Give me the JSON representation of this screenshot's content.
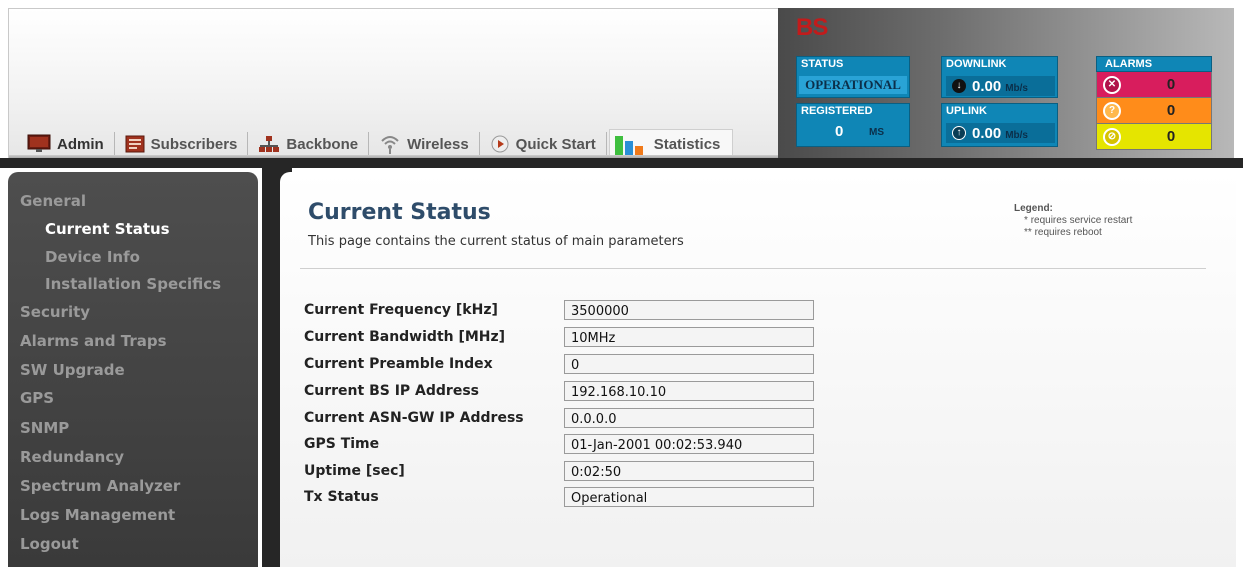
{
  "tabs": [
    {
      "label": "Admin",
      "icon": "monitor-icon"
    },
    {
      "label": "Subscribers",
      "icon": "subscribers-icon"
    },
    {
      "label": "Backbone",
      "icon": "backbone-icon"
    },
    {
      "label": "Wireless",
      "icon": "wireless-icon"
    },
    {
      "label": "Quick Start",
      "icon": "play-icon"
    },
    {
      "label": "Statistics",
      "icon": "bar-chart-icon"
    }
  ],
  "device": {
    "title": "BS",
    "status": {
      "label": "STATUS",
      "value": "OPERATIONAL"
    },
    "registered": {
      "label": "REGISTERED",
      "value": "0",
      "unit": "MS"
    },
    "downlink": {
      "label": "DOWNLINK",
      "value": "0.00",
      "unit": "Mb/s"
    },
    "uplink": {
      "label": "UPLINK",
      "value": "0.00",
      "unit": "Mb/s"
    },
    "alarms": {
      "label": "ALARMS",
      "critical": "0",
      "major": "0",
      "minor": "0"
    }
  },
  "sidebar": {
    "items": [
      {
        "label": "General"
      },
      {
        "label": "Current Status"
      },
      {
        "label": "Device Info"
      },
      {
        "label": "Installation Specifics"
      },
      {
        "label": "Security"
      },
      {
        "label": "Alarms and Traps"
      },
      {
        "label": "SW Upgrade"
      },
      {
        "label": "GPS"
      },
      {
        "label": "SNMP"
      },
      {
        "label": "Redundancy"
      },
      {
        "label": "Spectrum Analyzer"
      },
      {
        "label": "Logs Management"
      },
      {
        "label": "Logout"
      }
    ]
  },
  "main": {
    "title": "Current Status",
    "description": "This page contains the current status of main parameters",
    "legend": {
      "title": "Legend:",
      "line1": "requires service restart",
      "line2": "requires reboot",
      "mark1": "*",
      "mark2": "**"
    },
    "fields": [
      {
        "label": "Current Frequency [kHz]",
        "value": "3500000"
      },
      {
        "label": "Current Bandwidth [MHz]",
        "value": "10MHz"
      },
      {
        "label": "Current Preamble Index",
        "value": "0"
      },
      {
        "label": "Current BS IP Address",
        "value": "192.168.10.10"
      },
      {
        "label": "Current ASN-GW IP Address",
        "value": "0.0.0.0"
      },
      {
        "label": "GPS Time",
        "value": "01-Jan-2001 00:02:53.940"
      },
      {
        "label": "Uptime [sec]",
        "value": "0:02:50"
      },
      {
        "label": "Tx Status",
        "value": "Operational"
      }
    ]
  }
}
